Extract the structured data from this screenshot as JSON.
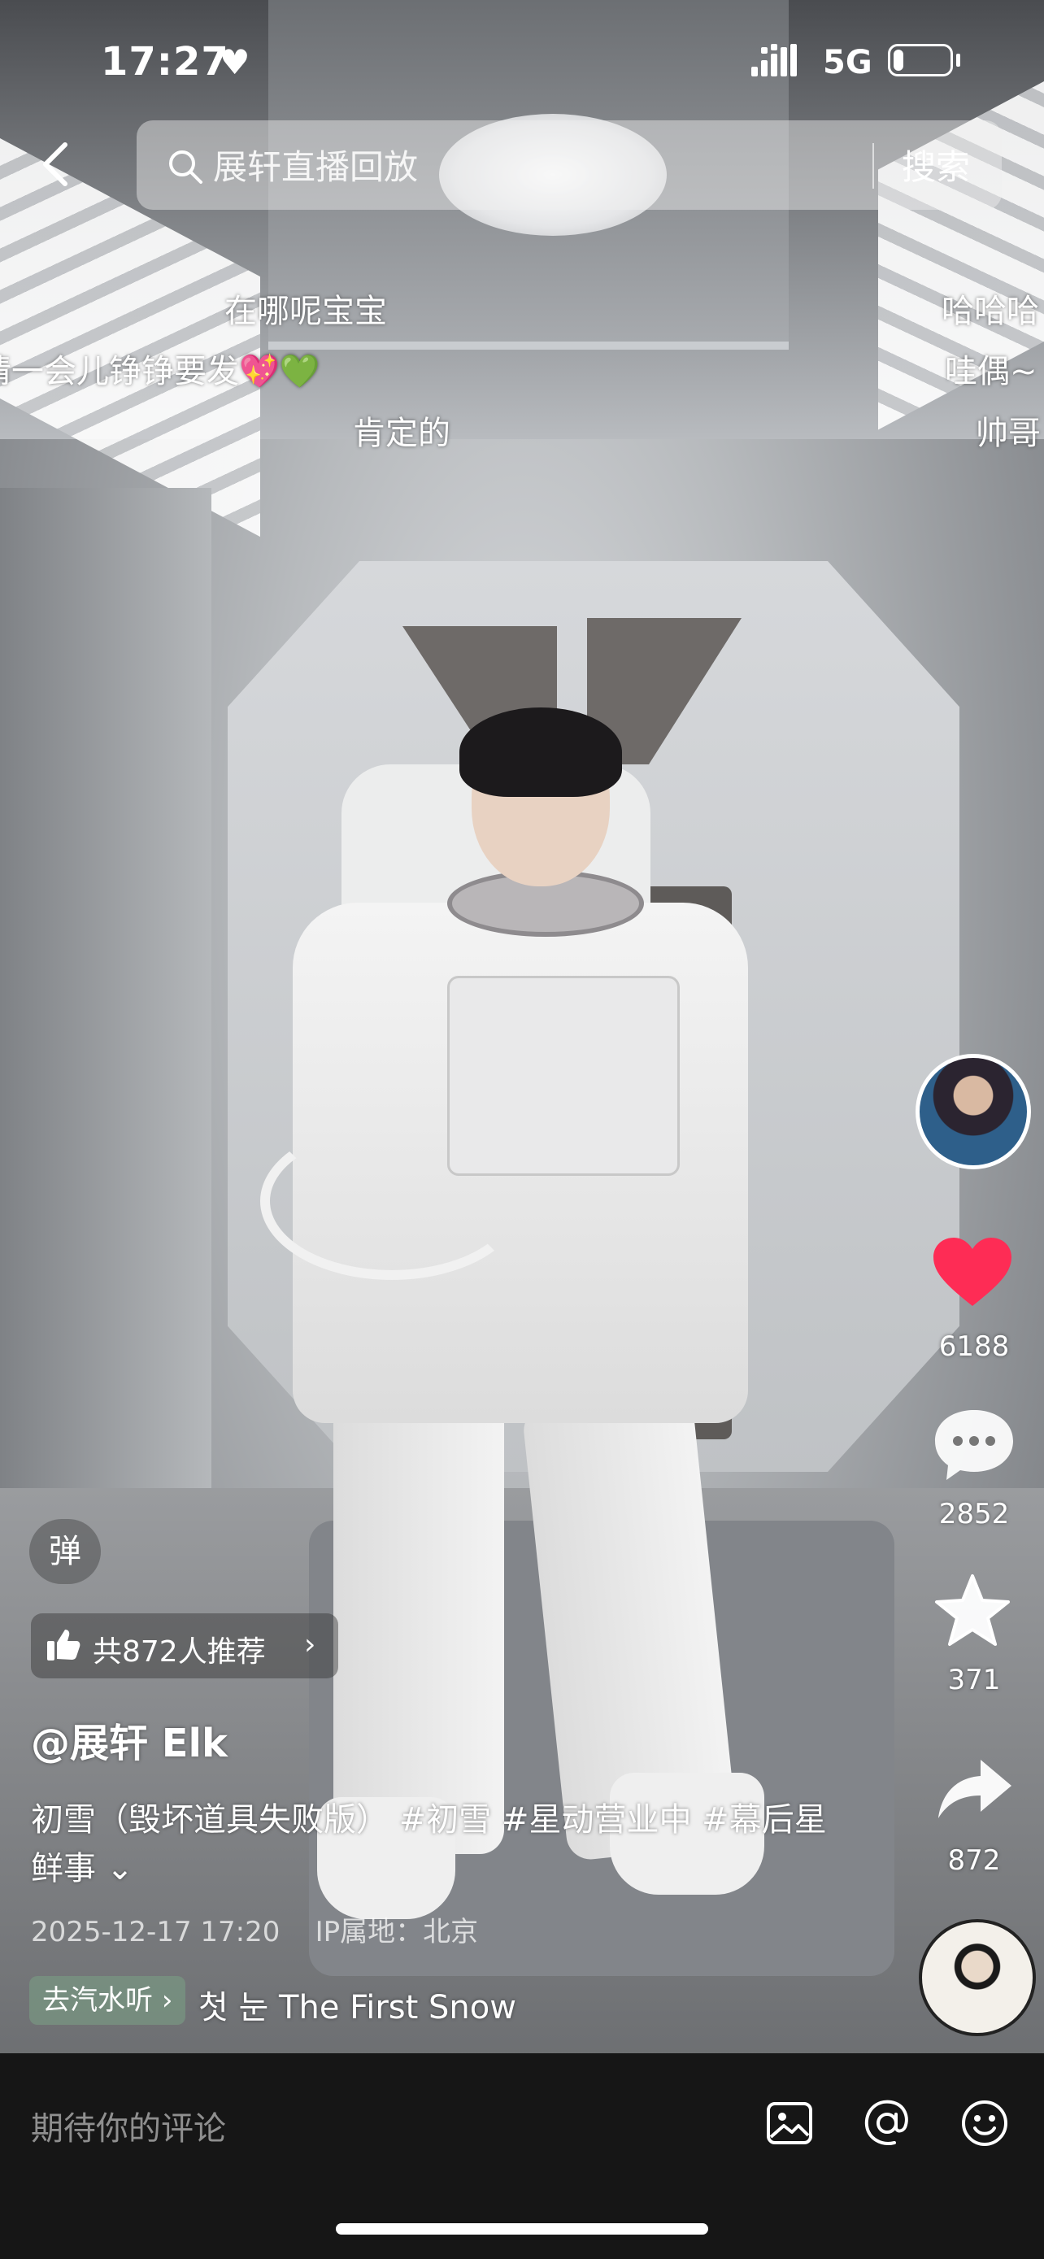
{
  "status_bar": {
    "time": "17:27",
    "heart_icon": "heart-icon",
    "network": "5G",
    "battery_level": 0.18
  },
  "search": {
    "placeholder": "展轩直播回放",
    "button": "搜索"
  },
  "danmaku": [
    {
      "text": "在哪呢宝宝"
    },
    {
      "text": "猜一会儿铮铮要发💖💚"
    },
    {
      "text": "肯定的"
    },
    {
      "text": "哈哈哈"
    },
    {
      "text": "哇偶~"
    },
    {
      "text": "帅哥"
    }
  ],
  "actions": {
    "likes": "6188",
    "comments": "2852",
    "favorites": "371",
    "shares": "872",
    "like_color": "#fe2c55"
  },
  "danmaku_toggle": "弹",
  "recommend": {
    "text": "共872人推荐",
    "chevron": "›"
  },
  "post": {
    "author": "@展轩 Elk",
    "description": "初雪（毁坏道具失败版） #初雪 #星动营业中 #幕后星鲜事",
    "expand": "⌄",
    "timestamp": "2025-12-17 17:20",
    "location": "IP属地：北京"
  },
  "music": {
    "tag": "去汽水听",
    "tag_chevron": "›",
    "title": "첫 눈 The First Snow"
  },
  "comment_bar": {
    "placeholder": "期待你的评论",
    "icons": [
      "image-icon",
      "at-icon",
      "emoji-icon"
    ]
  }
}
